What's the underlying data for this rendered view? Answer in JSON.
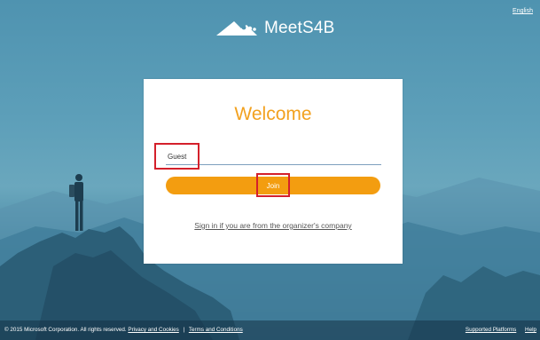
{
  "header": {
    "brand_name": "MeetS4B",
    "language": "English"
  },
  "card": {
    "title": "Welcome",
    "name_value": "Guest",
    "join_label": "Join",
    "signin_link": "Sign in if you are from the organizer's company"
  },
  "footer": {
    "copyright": "© 2015 Microsoft Corporation. All rights reserved.",
    "privacy_link": "Privacy and Cookies",
    "separator": "|",
    "terms_link": "Terms and Conditions",
    "supported_link": "Supported Platforms",
    "help_link": "Help"
  },
  "colors": {
    "accent": "#f39d10",
    "highlight": "#d4202b",
    "underline": "#7e9fbe"
  },
  "icons": {
    "brand": "meets4b-logo-icon"
  }
}
